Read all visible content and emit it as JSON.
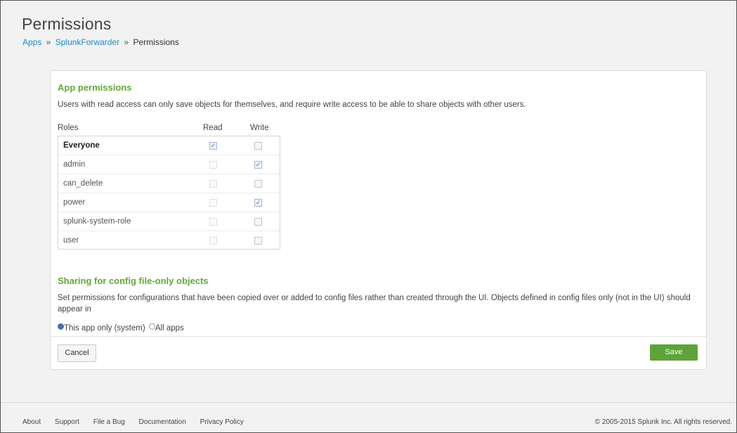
{
  "page": {
    "title": "Permissions",
    "breadcrumb": [
      {
        "label": "Apps"
      },
      {
        "label": "SplunkForwarder"
      },
      {
        "label": "Permissions"
      }
    ],
    "separator": "»"
  },
  "app_permissions": {
    "heading": "App permissions",
    "description": "Users with read access can only save objects for themselves, and require write access to be able to share objects with other users.",
    "columns": {
      "roles": "Roles",
      "read": "Read",
      "write": "Write"
    },
    "roles": [
      {
        "name": "Everyone",
        "read": true,
        "write": false,
        "read_enabled": true,
        "write_enabled": true
      },
      {
        "name": "admin",
        "read": false,
        "write": true,
        "read_enabled": false,
        "write_enabled": true
      },
      {
        "name": "can_delete",
        "read": false,
        "write": false,
        "read_enabled": false,
        "write_enabled": true
      },
      {
        "name": "power",
        "read": false,
        "write": true,
        "read_enabled": false,
        "write_enabled": true
      },
      {
        "name": "splunk-system-role",
        "read": false,
        "write": false,
        "read_enabled": false,
        "write_enabled": true
      },
      {
        "name": "user",
        "read": false,
        "write": false,
        "read_enabled": false,
        "write_enabled": true
      }
    ]
  },
  "sharing": {
    "heading": "Sharing for config file-only objects",
    "description": "Set permissions for configurations that have been copied over or added to config files rather than created through the UI. Objects defined in config files only (not in the UI) should appear in",
    "options": [
      {
        "label": "This app only (system)",
        "selected": true
      },
      {
        "label": "All apps",
        "selected": false
      }
    ]
  },
  "actions": {
    "cancel": "Cancel",
    "save": "Save"
  },
  "footer": {
    "links": [
      "About",
      "Support",
      "File a Bug",
      "Documentation",
      "Privacy Policy"
    ],
    "copyright": "© 2005-2015 Splunk Inc. All rights reserved."
  },
  "colors": {
    "accent_green": "#65a637",
    "link_blue": "#1a8ccc",
    "save_button": "#5da33a"
  }
}
